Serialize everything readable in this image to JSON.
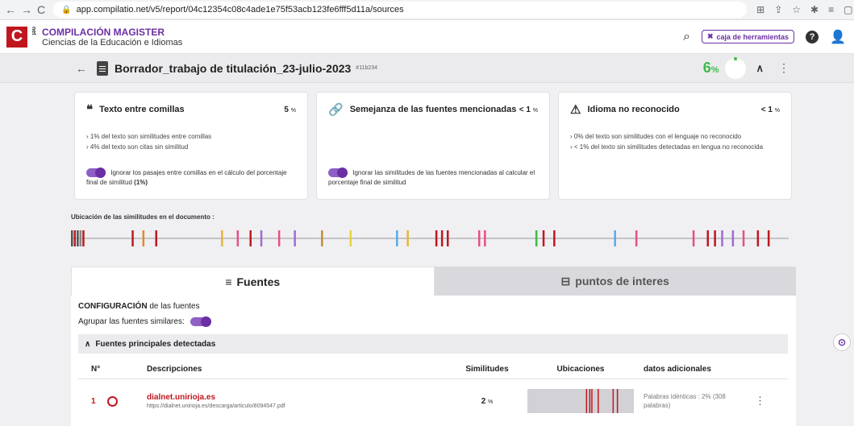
{
  "browser": {
    "url": "app.compilatio.net/v5/report/04c12354c08c4ade1e75f53acb123fe6fff5d11a/sources",
    "back": "←",
    "forward": "→",
    "reload": "C"
  },
  "header": {
    "logo_letter": "C",
    "logo_side": "net",
    "title": "COMPILACIÓN MAGISTER",
    "subtitle": "Ciencias de la Educación e Idiomas",
    "toolbox_label": "caja de herramientas",
    "help": "?"
  },
  "doc": {
    "title": "Borrador_trabajo de titulación_23-julio-2023",
    "id": "#11b234",
    "score": "6",
    "score_unit": "%"
  },
  "cards": [
    {
      "title": "Texto entre comillas",
      "pct": "5",
      "pct_unit": "%",
      "lines": [
        "›  1% del texto son similitudes entre comillas",
        "›  4% del texto son citas sin similitud"
      ],
      "toggle_text": "Ignorar los pasajes entre comillas en el cálculo del porcentaje final de similitud",
      "toggle_bold": "(1%)"
    },
    {
      "title": "Semejanza de las fuentes mencionadas",
      "pct": "< 1",
      "pct_unit": "%",
      "lines": [],
      "toggle_text": "Ignorar las similitudes de las fuentes mencionadas al calcular el porcentaje final de similitud",
      "toggle_bold": ""
    },
    {
      "title": "Idioma no reconocido",
      "pct": "< 1",
      "pct_unit": "%",
      "lines": [
        "›  0% del texto son similitudes con el lenguaje no reconocido",
        "›  < 1% del texto sin similitudes detectadas en lengua no reconocida"
      ],
      "toggle_text": "",
      "toggle_bold": ""
    }
  ],
  "locations": {
    "label": "Ubicación de las similitudes en el documento :",
    "marks": [
      {
        "pos": 0.0,
        "color": "#555555"
      },
      {
        "pos": 0.004,
        "color": "#c0171f"
      },
      {
        "pos": 0.008,
        "color": "#555555"
      },
      {
        "pos": 0.012,
        "color": "#888888"
      },
      {
        "pos": 0.016,
        "color": "#c0171f"
      },
      {
        "pos": 0.085,
        "color": "#c0171f"
      },
      {
        "pos": 0.1,
        "color": "#e08a2a"
      },
      {
        "pos": 0.118,
        "color": "#c0171f"
      },
      {
        "pos": 0.21,
        "color": "#e4b63a"
      },
      {
        "pos": 0.232,
        "color": "#e84d8a"
      },
      {
        "pos": 0.25,
        "color": "#c0171f"
      },
      {
        "pos": 0.265,
        "color": "#a06ad6"
      },
      {
        "pos": 0.29,
        "color": "#e84d8a"
      },
      {
        "pos": 0.312,
        "color": "#a06ad6"
      },
      {
        "pos": 0.35,
        "color": "#c09030"
      },
      {
        "pos": 0.39,
        "color": "#e4d33a"
      },
      {
        "pos": 0.455,
        "color": "#5aa9e6"
      },
      {
        "pos": 0.47,
        "color": "#e4b63a"
      },
      {
        "pos": 0.51,
        "color": "#c0171f"
      },
      {
        "pos": 0.518,
        "color": "#c0171f"
      },
      {
        "pos": 0.526,
        "color": "#c0171f"
      },
      {
        "pos": 0.57,
        "color": "#e84d8a"
      },
      {
        "pos": 0.578,
        "color": "#e84d8a"
      },
      {
        "pos": 0.65,
        "color": "#3fb94a"
      },
      {
        "pos": 0.66,
        "color": "#c0171f"
      },
      {
        "pos": 0.675,
        "color": "#c0171f"
      },
      {
        "pos": 0.76,
        "color": "#5aa9e6"
      },
      {
        "pos": 0.79,
        "color": "#e84d8a"
      },
      {
        "pos": 0.87,
        "color": "#e84d8a"
      },
      {
        "pos": 0.89,
        "color": "#c0171f"
      },
      {
        "pos": 0.9,
        "color": "#c0171f"
      },
      {
        "pos": 0.91,
        "color": "#a06ad6"
      },
      {
        "pos": 0.925,
        "color": "#a06ad6"
      },
      {
        "pos": 0.94,
        "color": "#e84d8a"
      },
      {
        "pos": 0.96,
        "color": "#c0171f"
      },
      {
        "pos": 0.975,
        "color": "#c0171f"
      }
    ]
  },
  "tabs": [
    {
      "label": "Fuentes",
      "icon": "list-icon",
      "glyph": "≡"
    },
    {
      "label": "puntos de interes",
      "icon": "document-list-icon",
      "glyph": "⊟"
    }
  ],
  "config": {
    "heading_bold": "CONFIGURACIÓN",
    "heading_rest": " de las fuentes",
    "group_label": "Agrupar las fuentes similares:"
  },
  "sources": {
    "section_title": "Fuentes principales detectadas",
    "columns": [
      "N°",
      "Descripciones",
      "Similitudes",
      "Ubicaciones",
      "datos adicionales"
    ],
    "rows": [
      {
        "num": "1",
        "name": "dialnet.unirioja.es",
        "url": "https://dialnet.unirioja.es/descarga/articulo/8094547.pdf",
        "sim": "2",
        "sim_unit": "%",
        "extra": "Palabras idénticas : 2% (308 palabras)",
        "marks": [
          0.55,
          0.58,
          0.6,
          0.66,
          0.8,
          0.84
        ]
      }
    ]
  },
  "colors": {
    "brand_red": "#c0171f",
    "brand_purple": "#6b2fa4",
    "score_green": "#3fb94a"
  }
}
